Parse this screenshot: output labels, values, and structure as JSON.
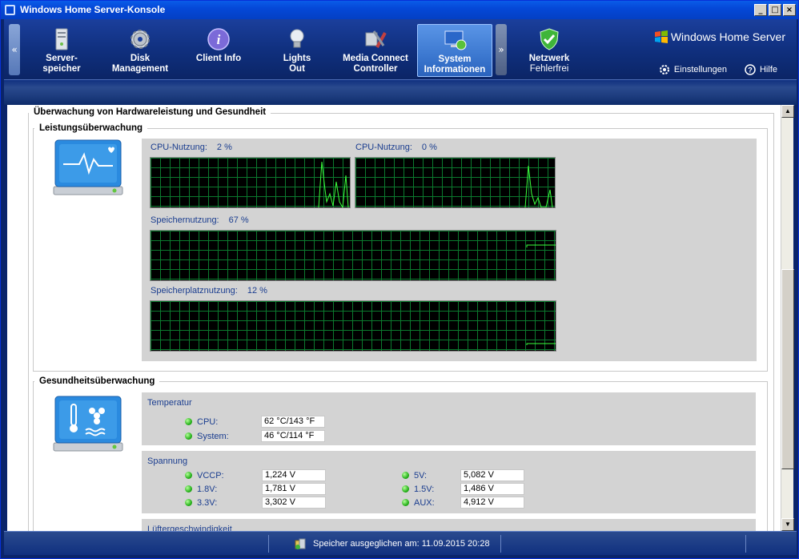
{
  "window": {
    "title": "Windows Home Server-Konsole"
  },
  "nav": {
    "tabs": [
      {
        "label": "Server-",
        "label2": "speicher",
        "icon": "server-icon"
      },
      {
        "label": "Disk",
        "label2": "Management",
        "icon": "gear-icon"
      },
      {
        "label": "Client Info",
        "label2": "",
        "icon": "info-icon"
      },
      {
        "label": "Lights",
        "label2": "Out",
        "icon": "lightbulb-icon"
      },
      {
        "label": "Media Connect",
        "label2": "Controller",
        "icon": "media-tools-icon"
      },
      {
        "label": "System",
        "label2": "Informationen",
        "icon": "system-monitor-icon"
      }
    ],
    "network": {
      "label": "Netzwerk",
      "status": "Fehlerfrei",
      "icon": "shield-check-icon"
    },
    "brand": "Windows Home Server",
    "settings": "Einstellungen",
    "help": "Hilfe"
  },
  "hw": {
    "title": "Überwachung von Hardwareleistung und Gesundheit",
    "perf": {
      "title": "Leistungsüberwachung",
      "cpu1": {
        "label": "CPU-Nutzung:",
        "value": "2 %"
      },
      "cpu2": {
        "label": "CPU-Nutzung:",
        "value": "0 %"
      },
      "mem": {
        "label": "Speichernutzung:",
        "value": "67 %"
      },
      "disk": {
        "label": "Speicherplatznutzung:",
        "value": "12 %"
      }
    },
    "health": {
      "title": "Gesundheitsüberwachung",
      "temperature": {
        "title": "Temperatur",
        "rows": [
          {
            "name": "CPU:",
            "value": "62 °C/143 °F"
          },
          {
            "name": "System:",
            "value": "46 °C/114 °F"
          }
        ]
      },
      "voltage": {
        "title": "Spannung",
        "left": [
          {
            "name": "VCCP:",
            "value": "1,224 V"
          },
          {
            "name": "1.8V:",
            "value": "1,781 V"
          },
          {
            "name": "3.3V:",
            "value": "3,302 V"
          }
        ],
        "right": [
          {
            "name": "5V:",
            "value": "5,082 V"
          },
          {
            "name": "1.5V:",
            "value": "1,486 V"
          },
          {
            "name": "AUX:",
            "value": "4,912 V"
          }
        ]
      },
      "fan": {
        "title": "Lüftergeschwindigkeit"
      }
    }
  },
  "status": {
    "message": "Speicher ausgeglichen am: 11.09.2015 20:28"
  }
}
